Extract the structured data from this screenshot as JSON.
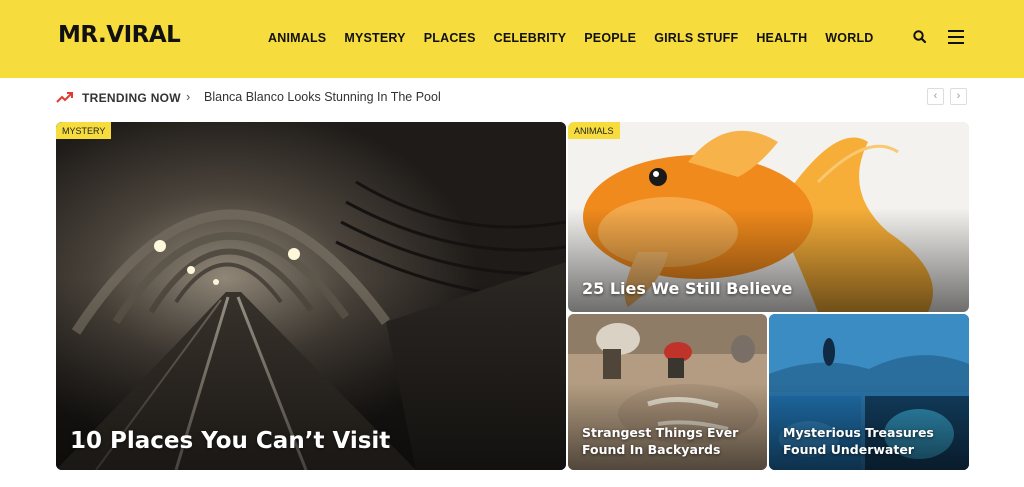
{
  "header": {
    "logo": "MR.VIRAL",
    "nav": [
      "ANIMALS",
      "MYSTERY",
      "PLACES",
      "CELEBRITY",
      "PEOPLE",
      "GIRLS STUFF",
      "HEALTH",
      "WORLD"
    ],
    "search_icon": "search-icon",
    "menu_icon": "hamburger-menu-icon",
    "colors": {
      "brand": "#f7dc3e",
      "text": "#111111"
    }
  },
  "trending": {
    "label": "TRENDING NOW",
    "headline": "Blanca Blanco Looks Stunning In The Pool",
    "icons": [
      "trending-up-icon",
      "chevron-right-icon",
      "arrow-left-icon",
      "arrow-right-icon"
    ],
    "prev": "‹",
    "next": "›",
    "separator": "›",
    "colors": {
      "icon": "#e23a2e"
    }
  },
  "cards": {
    "main": {
      "category": "MYSTERY",
      "title": "10 Places You Can’t Visit"
    },
    "fish": {
      "category": "ANIMALS",
      "title": "25 Lies We Still Believe"
    },
    "dig": {
      "title": "Strangest Things Ever Found In Backyards"
    },
    "sea": {
      "title": "Mysterious Treasures Found Underwater"
    }
  }
}
